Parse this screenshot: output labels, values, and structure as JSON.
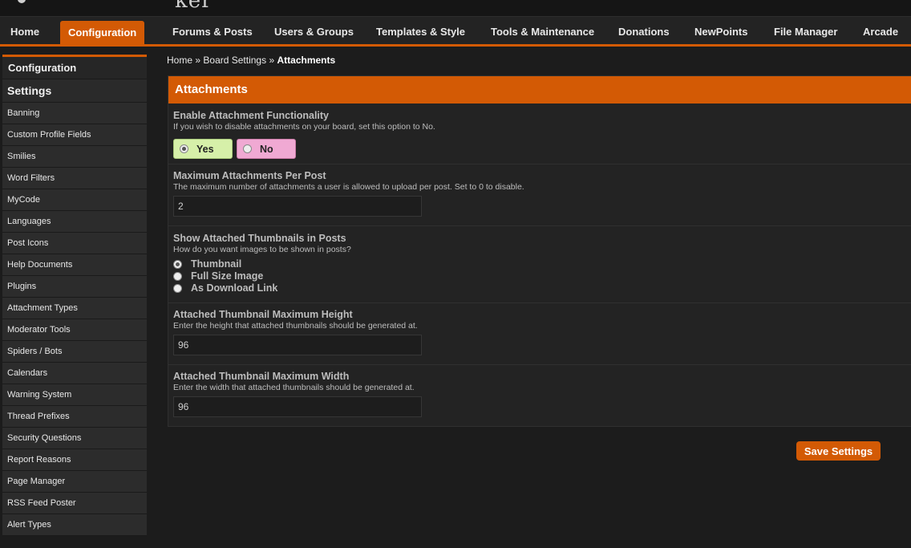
{
  "header": {
    "logo_fragment": "ker"
  },
  "nav": {
    "tabs": [
      {
        "label": "Home"
      },
      {
        "label": "Configuration"
      },
      {
        "label": "Forums & Posts"
      },
      {
        "label": "Users & Groups"
      },
      {
        "label": "Templates & Style"
      },
      {
        "label": "Tools & Maintenance"
      },
      {
        "label": "Donations"
      },
      {
        "label": "NewPoints"
      },
      {
        "label": "File Manager"
      },
      {
        "label": "Arcade"
      }
    ],
    "active_tab": "Configuration"
  },
  "sidebar": {
    "heading": "Configuration",
    "subheading": "Settings",
    "items": [
      {
        "label": "Banning"
      },
      {
        "label": "Custom Profile Fields"
      },
      {
        "label": "Smilies"
      },
      {
        "label": "Word Filters"
      },
      {
        "label": "MyCode"
      },
      {
        "label": "Languages"
      },
      {
        "label": "Post Icons"
      },
      {
        "label": "Help Documents"
      },
      {
        "label": "Plugins"
      },
      {
        "label": "Attachment Types"
      },
      {
        "label": "Moderator Tools"
      },
      {
        "label": "Spiders / Bots"
      },
      {
        "label": "Calendars"
      },
      {
        "label": "Warning System"
      },
      {
        "label": "Thread Prefixes"
      },
      {
        "label": "Security Questions"
      },
      {
        "label": "Report Reasons"
      },
      {
        "label": "Page Manager"
      },
      {
        "label": "RSS Feed Poster"
      },
      {
        "label": "Alert Types"
      }
    ]
  },
  "breadcrumb": {
    "home": "Home",
    "separator": "»",
    "board_settings": "Board Settings",
    "current": "Attachments"
  },
  "panel": {
    "title": "Attachments",
    "enable": {
      "title": "Enable Attachment Functionality",
      "desc": "If you wish to disable attachments on your board, set this option to No.",
      "yes_label": "Yes",
      "no_label": "No",
      "selected": "Yes"
    },
    "max_per_post": {
      "title": "Maximum Attachments Per Post",
      "desc": "The maximum number of attachments a user is allowed to upload per post. Set to 0 to disable.",
      "value": "2"
    },
    "thumbnails": {
      "title": "Show Attached Thumbnails in Posts",
      "desc": "How do you want images to be shown in posts?",
      "options": [
        {
          "label": "Thumbnail"
        },
        {
          "label": "Full Size Image"
        },
        {
          "label": "As Download Link"
        }
      ],
      "selected": "Thumbnail"
    },
    "thumb_height": {
      "title": "Attached Thumbnail Maximum Height",
      "desc": "Enter the height that attached thumbnails should be generated at.",
      "value": "96"
    },
    "thumb_width": {
      "title": "Attached Thumbnail Maximum Width",
      "desc": "Enter the width that attached thumbnails should be generated at.",
      "value": "96"
    }
  },
  "actions": {
    "save_label": "Save Settings"
  },
  "colors": {
    "accent": "#d35a05",
    "yes_bg": "#d6f0a9",
    "no_bg": "#f0a9d3",
    "background": "#1c1c1c"
  }
}
